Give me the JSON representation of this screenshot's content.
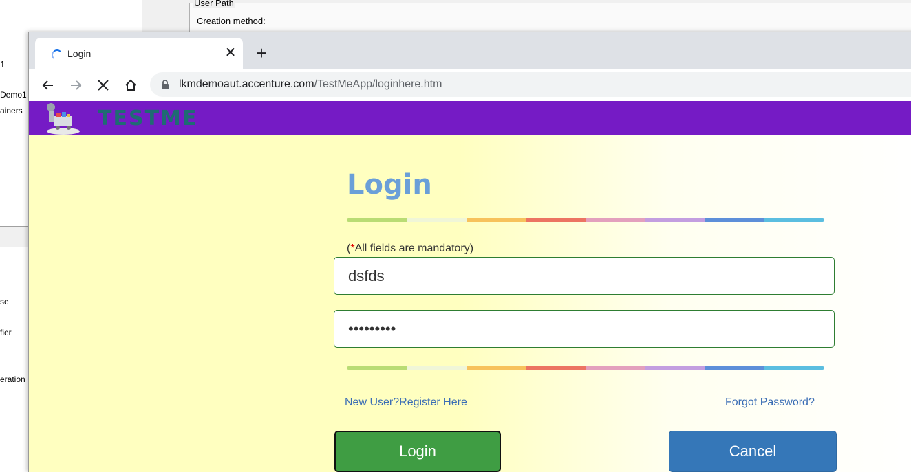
{
  "background_app": {
    "group_title": "User Path",
    "creation_method_label": "Creation method:",
    "left_fragments": [
      "1",
      "Demo1",
      "ainers",
      "se",
      "fier",
      "eration"
    ]
  },
  "browser": {
    "tab_title": "Login",
    "close_tab_symbol": "✕",
    "new_tab_symbol": "+",
    "url_host": "lkmdemoaut.accenture.com",
    "url_path": "/TestMeApp/loginhere.htm"
  },
  "site": {
    "logo_text": "TESTME",
    "header_color": "#751bc5"
  },
  "login_form": {
    "title": "Login",
    "mandatory_open": "(",
    "mandatory_star": "*",
    "mandatory_text": "All fields are mandatory)",
    "username_value": "dsfds",
    "password_value": "•••••••••",
    "register_link": "New User?Register Here",
    "forgot_link": "Forgot Password?",
    "login_button": "Login",
    "cancel_button": "Cancel",
    "rainbow_colors": [
      "#b9dc74",
      "#f0f6d8",
      "#f7c25c",
      "#ec7462",
      "#e3a0bd",
      "#c39ee0",
      "#5d8fd9",
      "#5bbee0"
    ]
  }
}
